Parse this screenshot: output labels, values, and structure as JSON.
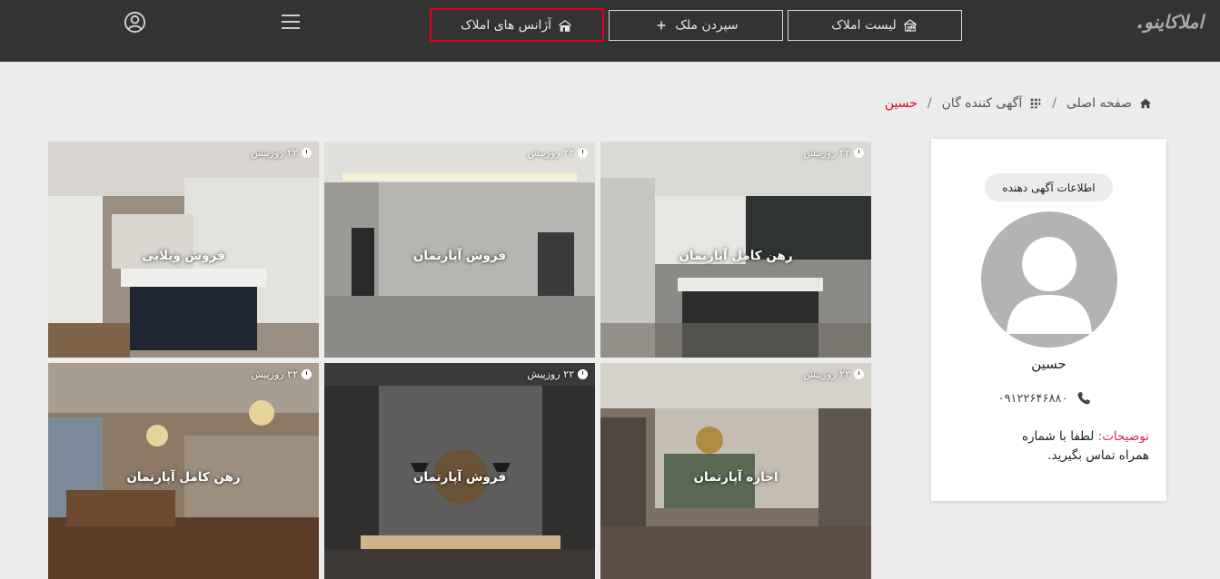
{
  "header": {
    "logo_main": "املاکاینو",
    "logo_dot": ".",
    "nav": {
      "list_label": "لیست املاک",
      "submit_label": "سپردن ملک",
      "agencies_label": "آژانس های املاک"
    }
  },
  "breadcrumb": {
    "home": "صفحه اصلی",
    "advertisers": "آگهی کننده گان",
    "current": "حسین"
  },
  "profile": {
    "badge": "اطلاعات آگهی دهنده",
    "name": "حسین",
    "phone": "۰۹۱۲۲۶۴۶۸۸۰",
    "desc_label": "توضیحات:",
    "desc_text": " لطفا با شماره همراه تماس بگیرید."
  },
  "listings": [
    {
      "title": "رهن کامل آپارتمان",
      "date": "۲۲ روزپیش"
    },
    {
      "title": "فروش آپارتمان",
      "date": "۲۲ روزپیش"
    },
    {
      "title": "فروش ویلایی",
      "date": "۲۲ روزپیش"
    },
    {
      "title": "اجاره آپارتمان",
      "date": "۲۲ روزپیش"
    },
    {
      "title": "فروش آپارتمان",
      "date": "۲۲ روزپیش"
    },
    {
      "title": "رهن کامل آپارتمان",
      "date": "۲۲ روزپیش"
    }
  ],
  "colors": {
    "header_bg": "#333333",
    "accent_red": "#e0001b",
    "desc_label": "#d6246e",
    "page_bg": "#ececec"
  },
  "icons": [
    "home-building-icon",
    "plus-icon",
    "agency-icon",
    "menu-icon",
    "user-circle-icon",
    "home-icon",
    "grid-icon",
    "phone-icon",
    "clock-icon",
    "avatar-icon"
  ]
}
